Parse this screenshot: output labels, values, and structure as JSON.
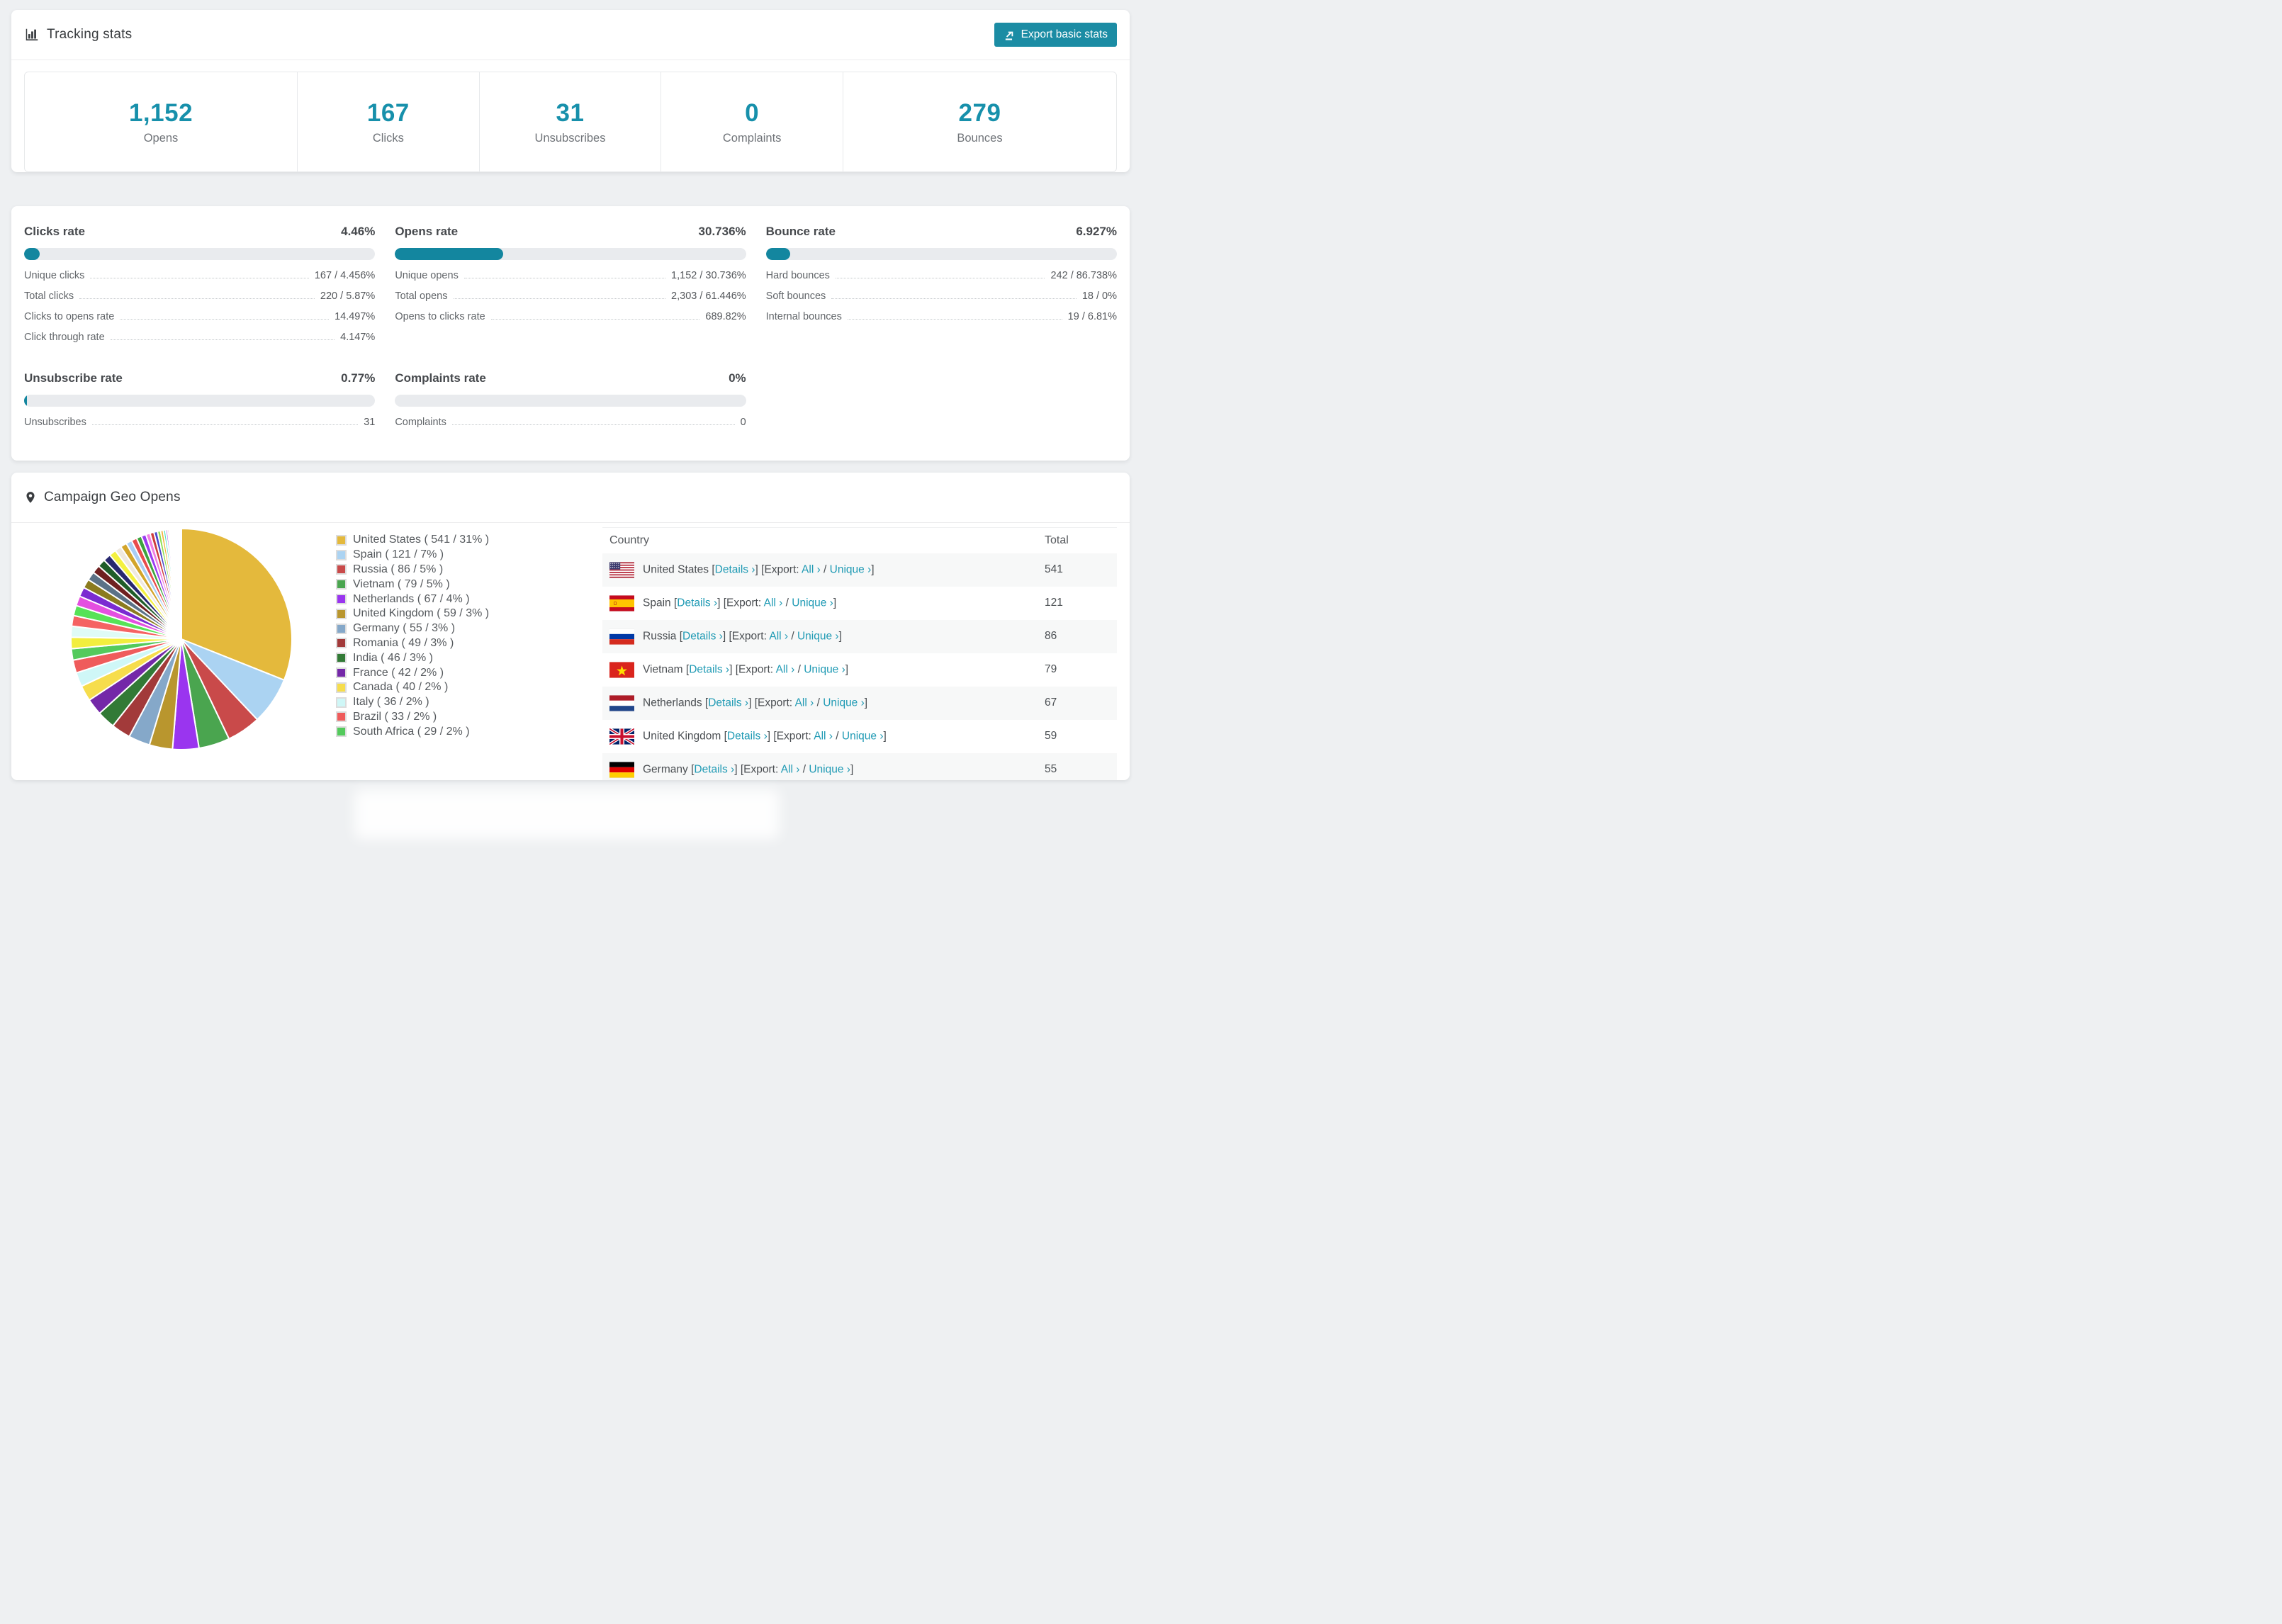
{
  "colors": {
    "accent": "#1790ab",
    "accent_dark": "#13869f",
    "button": "#1b8ca4",
    "link": "#1f9ab4",
    "bar_bg": "#e9ebee"
  },
  "tracking": {
    "title": "Tracking stats",
    "export_label": "Export basic stats",
    "stats": [
      {
        "value": "1,152",
        "label": "Opens"
      },
      {
        "value": "167",
        "label": "Clicks"
      },
      {
        "value": "31",
        "label": "Unsubscribes"
      },
      {
        "value": "0",
        "label": "Complaints"
      },
      {
        "value": "279",
        "label": "Bounces"
      }
    ]
  },
  "rates": {
    "panels": [
      {
        "id": "clicks-rate",
        "title": "Clicks rate",
        "value": "4.46%",
        "percent": 4.46,
        "rows": [
          [
            "Unique clicks",
            "167 / 4.456%"
          ],
          [
            "Total clicks",
            "220 / 5.87%"
          ],
          [
            "Clicks to opens rate",
            "14.497%"
          ],
          [
            "Click through rate",
            "4.147%"
          ]
        ]
      },
      {
        "id": "opens-rate",
        "title": "Opens rate",
        "value": "30.736%",
        "percent": 30.736,
        "rows": [
          [
            "Unique opens",
            "1,152 / 30.736%"
          ],
          [
            "Total opens",
            "2,303 / 61.446%"
          ],
          [
            "Opens to clicks rate",
            "689.82%"
          ]
        ]
      },
      {
        "id": "bounce-rate",
        "title": "Bounce rate",
        "value": "6.927%",
        "percent": 6.927,
        "rows": [
          [
            "Hard bounces",
            "242 / 86.738%"
          ],
          [
            "Soft bounces",
            "18 / 0%"
          ],
          [
            "Internal bounces",
            "19 / 6.81%"
          ]
        ]
      },
      {
        "id": "unsubscribe-rate",
        "title": "Unsubscribe rate",
        "value": "0.77%",
        "percent": 0.77,
        "rows": [
          [
            "Unsubscribes",
            "31"
          ]
        ]
      },
      {
        "id": "complaints-rate",
        "title": "Complaints rate",
        "value": "0%",
        "percent": 0,
        "rows": [
          [
            "Complaints",
            "0"
          ]
        ]
      }
    ]
  },
  "geo": {
    "title": "Campaign Geo Opens",
    "table": {
      "columns": [
        "Country",
        "Total"
      ],
      "labels": {
        "details": "Details ›",
        "export": "Export:",
        "all": "All ›",
        "unique": "Unique ›",
        "open_bracket": "[",
        "close_bracket": "]",
        "slash": "/"
      },
      "rows": [
        {
          "country": "United States",
          "flag": "us",
          "total": "541"
        },
        {
          "country": "Spain",
          "flag": "es",
          "total": "121"
        },
        {
          "country": "Russia",
          "flag": "ru",
          "total": "86"
        },
        {
          "country": "Vietnam",
          "flag": "vn",
          "total": "79"
        },
        {
          "country": "Netherlands",
          "flag": "nl",
          "total": "67"
        },
        {
          "country": "United Kingdom",
          "flag": "gb",
          "total": "59"
        },
        {
          "country": "Germany",
          "flag": "de",
          "total": "55"
        }
      ]
    }
  },
  "chart_data": {
    "type": "pie",
    "title": "Campaign Geo Opens",
    "legend_position": "right",
    "slices": [
      {
        "name": "United States",
        "value": 541,
        "pct": "31%",
        "color": "#e4b93c"
      },
      {
        "name": "Spain",
        "value": 121,
        "pct": "7%",
        "color": "#abd3f2"
      },
      {
        "name": "Russia",
        "value": 86,
        "pct": "5%",
        "color": "#c94a4a"
      },
      {
        "name": "Vietnam",
        "value": 79,
        "pct": "5%",
        "color": "#4aa54f"
      },
      {
        "name": "Netherlands",
        "value": 67,
        "pct": "4%",
        "color": "#9a35ef"
      },
      {
        "name": "United Kingdom",
        "value": 59,
        "pct": "3%",
        "color": "#b9962e"
      },
      {
        "name": "Germany",
        "value": 55,
        "pct": "3%",
        "color": "#85a8c9"
      },
      {
        "name": "Romania",
        "value": 49,
        "pct": "3%",
        "color": "#a23a3a"
      },
      {
        "name": "India",
        "value": 46,
        "pct": "3%",
        "color": "#327a36"
      },
      {
        "name": "France",
        "value": 42,
        "pct": "2%",
        "color": "#7428a8"
      },
      {
        "name": "Canada",
        "value": 40,
        "pct": "2%",
        "color": "#f6dd4c"
      },
      {
        "name": "Italy",
        "value": 36,
        "pct": "2%",
        "color": "#cff7f7"
      },
      {
        "name": "Brazil",
        "value": 33,
        "pct": "2%",
        "color": "#ef5b5b"
      },
      {
        "name": "South Africa",
        "value": 29,
        "pct": "2%",
        "color": "#53ca5c"
      }
    ],
    "unlabeled_small_slices": {
      "values": [
        29,
        28,
        27,
        26,
        25,
        24,
        23,
        22,
        21,
        20,
        19,
        18,
        17,
        16,
        15,
        14,
        13,
        12,
        11,
        10,
        9,
        8,
        7,
        6,
        5,
        4,
        3,
        3,
        2,
        2,
        2,
        2,
        2,
        2,
        2,
        1,
        1,
        1,
        1,
        1,
        1,
        1,
        1,
        1,
        1,
        1
      ],
      "colors": [
        "#f2ee3e",
        "#dffbf6",
        "#f56363",
        "#57e257",
        "#e44fe0",
        "#7b2bd1",
        "#8b7b1f",
        "#5b7287",
        "#6f2020",
        "#1f5d29",
        "#28286f",
        "#f4f140",
        "#efe9e0",
        "#d3a52b",
        "#a9cdf3",
        "#e84c4c",
        "#3ea33e",
        "#9b3cf1",
        "#f17fe3",
        "#cd3c3c",
        "#4848ca",
        "#8be050",
        "#f1b13d",
        "#57e0c0",
        "#b05cf0",
        "#e0557a",
        "#7fd4f0",
        "#c9e04e",
        "#8a5a20",
        "#3a8a8a",
        "#aa3a6a",
        "#5a3aaa",
        "#e07a3a",
        "#3ae07a",
        "#e03a3a",
        "#3a3ae0",
        "#e0e03a",
        "#a0a0a0",
        "#70c0e0",
        "#e070c0",
        "#c0e070",
        "#7070e0",
        "#e07070",
        "#70e070",
        "#d0b040",
        "#40b0d0"
      ]
    }
  }
}
